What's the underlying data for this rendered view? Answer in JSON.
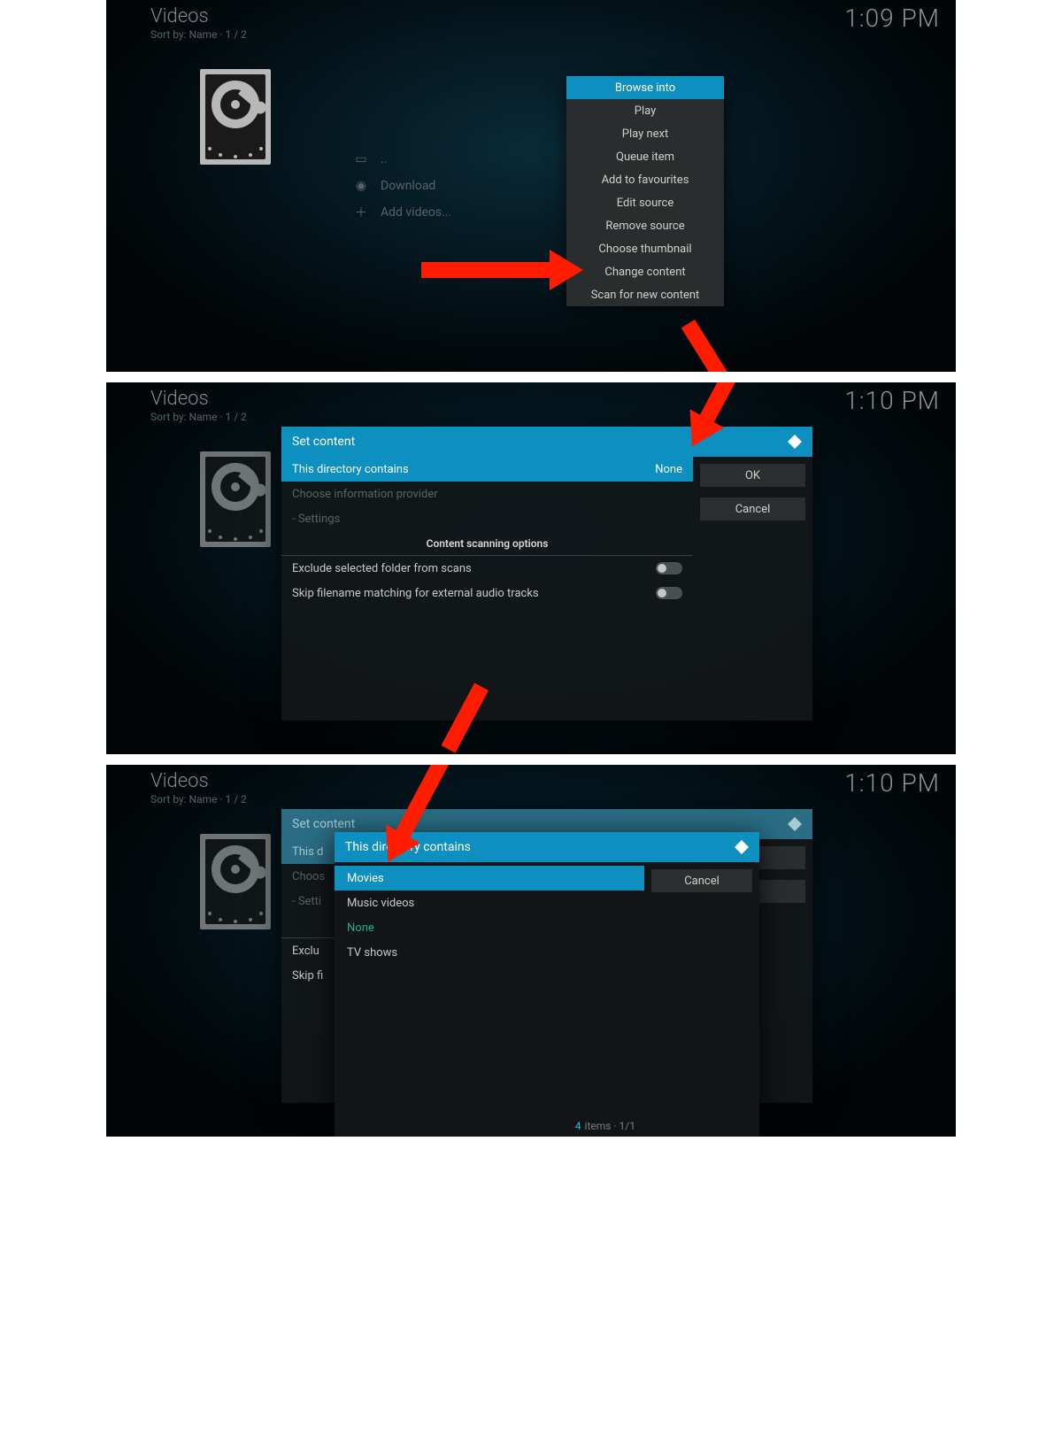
{
  "hdr": {
    "title": "Videos",
    "sub": "Sort by: Name  ·  1 / 2"
  },
  "clock": {
    "p1": "1:09 PM",
    "p2": "1:10 PM",
    "p3": "1:10 PM"
  },
  "flist": {
    "up": "..",
    "download": "Download",
    "add": "Add videos..."
  },
  "ctx": {
    "browse": "Browse into",
    "play": "Play",
    "playnext": "Play next",
    "queue": "Queue item",
    "fav": "Add to favourites",
    "editsrc": "Edit source",
    "removesrc": "Remove source",
    "thumb": "Choose thumbnail",
    "changecontent": "Change content",
    "scan": "Scan for new content"
  },
  "dlg": {
    "title": "Set content",
    "dir": "This directory contains",
    "dir_val": "None",
    "provider": "Choose information provider",
    "settings": "- Settings",
    "scanhdr": "Content scanning options",
    "exclude": "Exclude selected folder from scans",
    "skip": "Skip filename matching for external audio tracks",
    "ok": "OK",
    "cancel": "Cancel"
  },
  "inner": {
    "title": "This directory contains",
    "movies": "Movies",
    "music": "Music videos",
    "none": "None",
    "tv": "TV shows",
    "cancel": "Cancel",
    "count": "4",
    "count_label": "items  ·  1/1"
  },
  "p3rows": {
    "dir": "This d",
    "provider": "Choos",
    "settings": "- Setti",
    "exclude": "Exclu",
    "skip": "Skip fi"
  }
}
